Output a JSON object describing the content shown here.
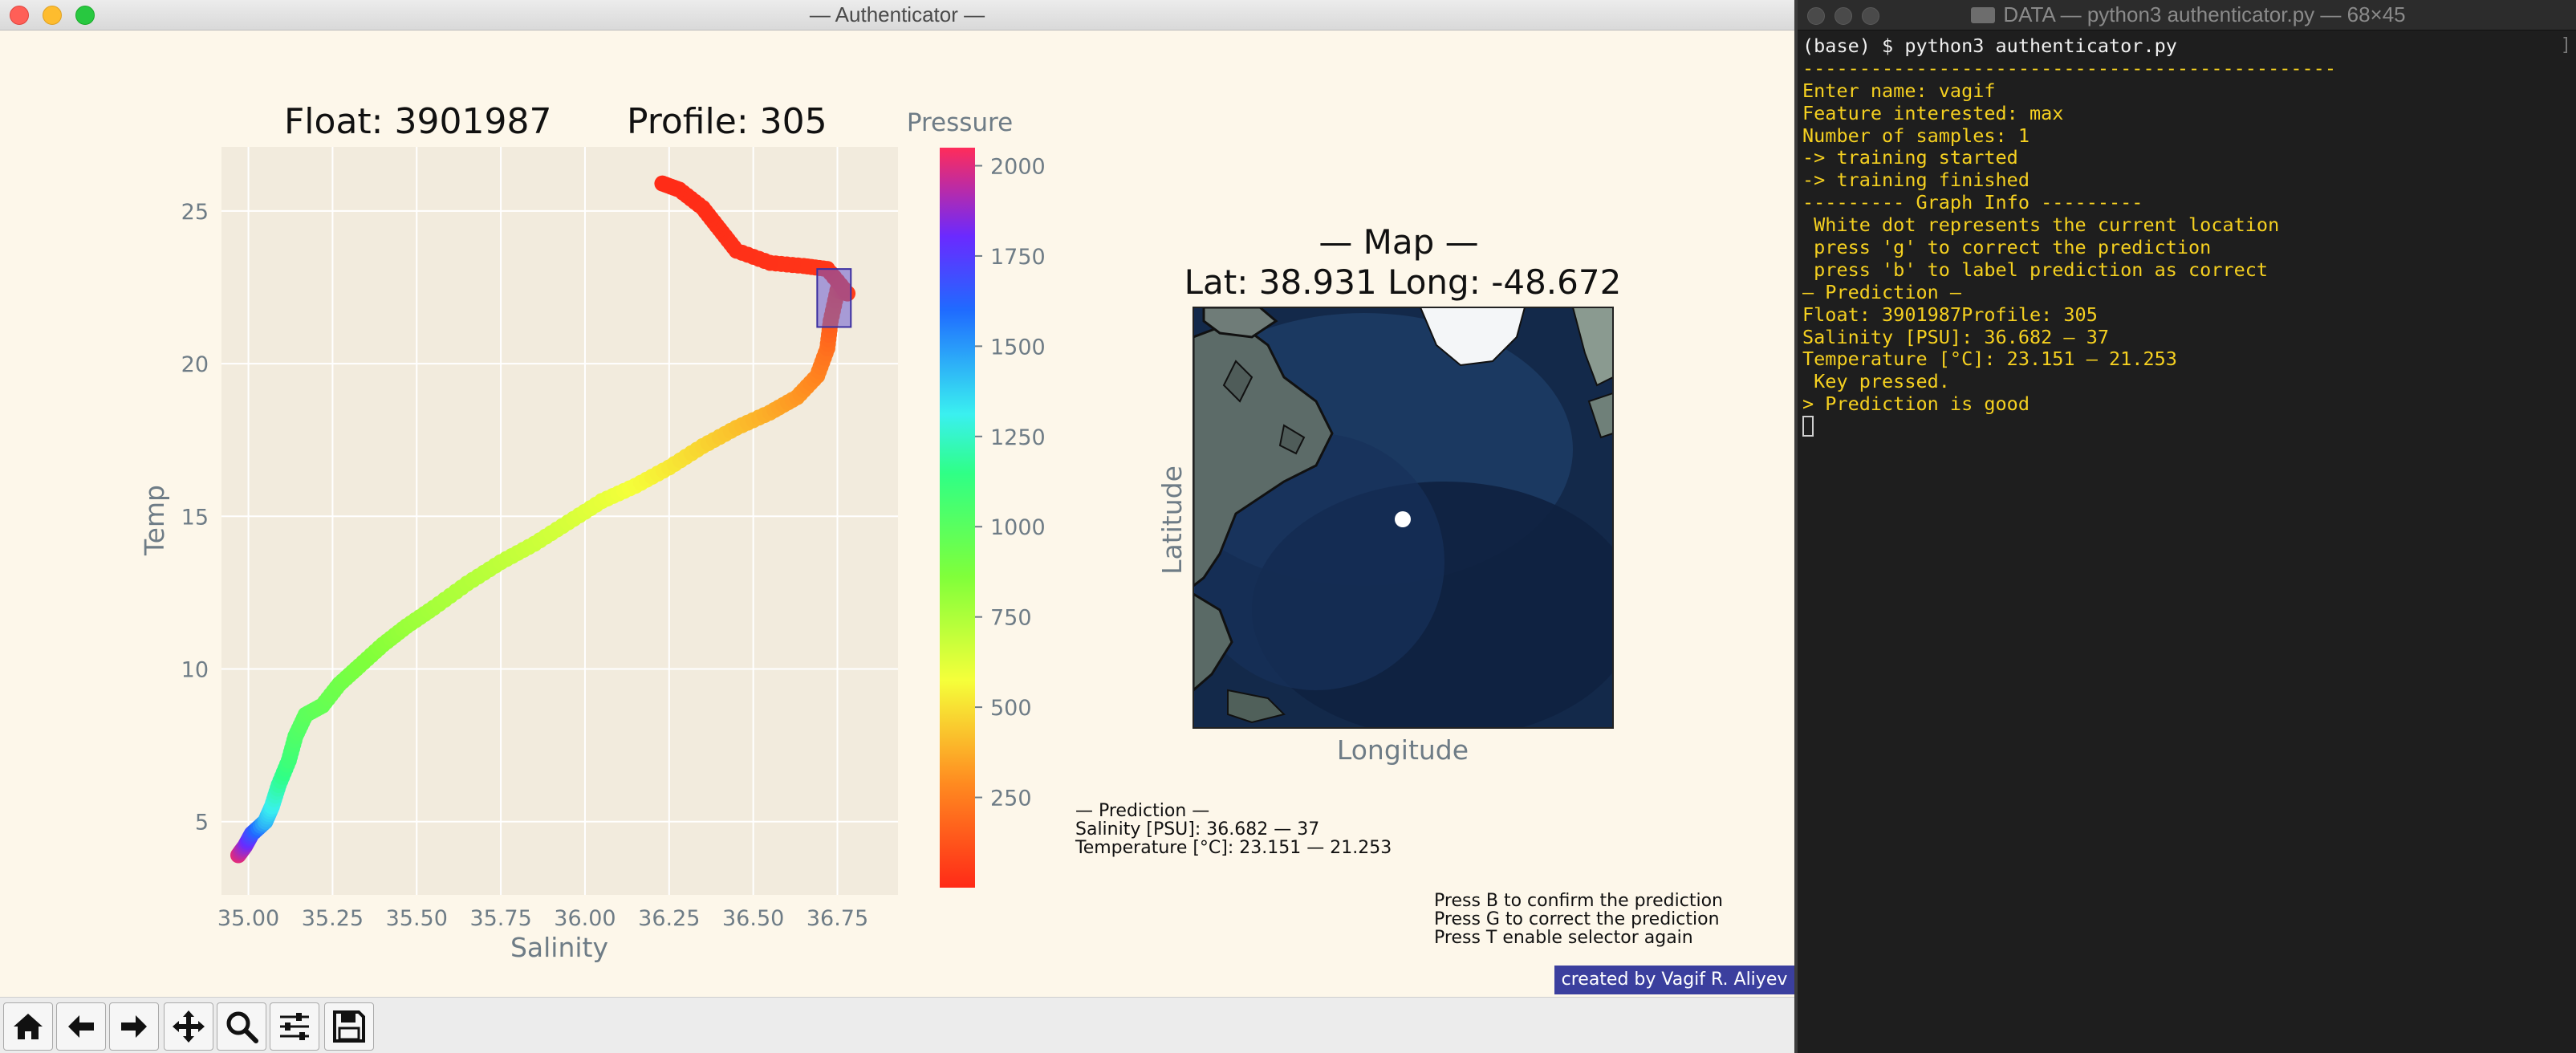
{
  "window": {
    "title": "— Authenticator —"
  },
  "plot": {
    "title_float": "Float: 3901987",
    "title_profile": "Profile: 305",
    "xlabel": "Salinity",
    "ylabel": "Temp",
    "xticks": [
      "35.00",
      "35.25",
      "35.50",
      "35.75",
      "36.00",
      "36.25",
      "36.50",
      "36.75"
    ],
    "yticks": [
      "5",
      "10",
      "15",
      "20",
      "25"
    ],
    "colorbar_label": "Pressure",
    "colorbar_ticks": [
      "2000",
      "1750",
      "1500",
      "1250",
      "1000",
      "750",
      "500",
      "250"
    ]
  },
  "map": {
    "title": "— Map —",
    "coords": "Lat: 38.931 Long: -48.672",
    "xlabel": "Longitude",
    "ylabel": "Latitude"
  },
  "prediction_box": {
    "heading": "— Prediction —",
    "salinity": "Salinity [PSU]: 36.682 — 37",
    "temperature": "Temperature [°C]: 23.151 — 21.253"
  },
  "instructions": [
    "Press B to confirm the prediction",
    "Press G to correct the prediction",
    "Press T enable selector again"
  ],
  "credit": "created by Vagif R. Aliyev",
  "toolbar": [
    {
      "name": "home-icon"
    },
    {
      "name": "back-arrow-icon"
    },
    {
      "name": "forward-arrow-icon"
    },
    {
      "name": "pan-icon"
    },
    {
      "name": "zoom-icon"
    },
    {
      "name": "configure-subplots-icon"
    },
    {
      "name": "save-icon"
    }
  ],
  "terminal": {
    "title": "DATA — python3 authenticator.py — 68×45",
    "lines": [
      "(base) $ python3 authenticator.py",
      "-----------------------------------------------",
      "Enter name: vagif",
      "Feature interested: max",
      "Number of samples: 1",
      "-> training started",
      "-> training finished",
      "--------- Graph Info ---------",
      " White dot represents the current location",
      " press 'g' to correct the prediction",
      " press 'b' to label prediction as correct",
      "— Prediction —",
      "Float: 3901987Profile: 305",
      "Salinity [PSU]: 36.682 — 37",
      "Temperature [°C]: 23.151 — 21.253",
      " Key pressed.",
      "> Prediction is good"
    ]
  },
  "chart_data": {
    "type": "scatter",
    "title": "Float: 3901987      Profile: 305",
    "xlabel": "Salinity",
    "ylabel": "Temp",
    "xlim": [
      34.92,
      36.93
    ],
    "ylim": [
      2.6,
      27.1
    ],
    "colorbar": {
      "label": "Pressure",
      "range": [
        0,
        2050
      ],
      "colormap": "rainbow_r"
    },
    "selection": {
      "x": [
        36.69,
        36.79
      ],
      "y": [
        21.2,
        23.1
      ]
    },
    "points": [
      {
        "x": 34.97,
        "y": 3.9,
        "p": 2000
      },
      {
        "x": 34.99,
        "y": 4.2,
        "p": 1880
      },
      {
        "x": 35.01,
        "y": 4.6,
        "p": 1700
      },
      {
        "x": 35.05,
        "y": 5.0,
        "p": 1450
      },
      {
        "x": 35.07,
        "y": 5.5,
        "p": 1320
      },
      {
        "x": 35.09,
        "y": 6.2,
        "p": 1200
      },
      {
        "x": 35.12,
        "y": 7.0,
        "p": 1100
      },
      {
        "x": 35.14,
        "y": 7.8,
        "p": 1040
      },
      {
        "x": 35.17,
        "y": 8.5,
        "p": 990
      },
      {
        "x": 35.22,
        "y": 8.8,
        "p": 960
      },
      {
        "x": 35.27,
        "y": 9.5,
        "p": 920
      },
      {
        "x": 35.33,
        "y": 10.1,
        "p": 880
      },
      {
        "x": 35.4,
        "y": 10.8,
        "p": 840
      },
      {
        "x": 35.47,
        "y": 11.4,
        "p": 800
      },
      {
        "x": 35.55,
        "y": 12.0,
        "p": 770
      },
      {
        "x": 35.65,
        "y": 12.8,
        "p": 740
      },
      {
        "x": 35.75,
        "y": 13.5,
        "p": 710
      },
      {
        "x": 35.85,
        "y": 14.1,
        "p": 680
      },
      {
        "x": 35.95,
        "y": 14.8,
        "p": 650
      },
      {
        "x": 36.05,
        "y": 15.5,
        "p": 610
      },
      {
        "x": 36.15,
        "y": 16.0,
        "p": 570
      },
      {
        "x": 36.25,
        "y": 16.6,
        "p": 520
      },
      {
        "x": 36.35,
        "y": 17.3,
        "p": 470
      },
      {
        "x": 36.45,
        "y": 17.9,
        "p": 420
      },
      {
        "x": 36.55,
        "y": 18.4,
        "p": 370
      },
      {
        "x": 36.63,
        "y": 18.9,
        "p": 320
      },
      {
        "x": 36.69,
        "y": 19.6,
        "p": 270
      },
      {
        "x": 36.72,
        "y": 20.5,
        "p": 210
      },
      {
        "x": 36.73,
        "y": 21.4,
        "p": 150
      },
      {
        "x": 36.75,
        "y": 22.4,
        "p": 100
      },
      {
        "x": 36.78,
        "y": 22.3,
        "p": 60
      },
      {
        "x": 36.72,
        "y": 23.1,
        "p": 40
      },
      {
        "x": 36.65,
        "y": 23.2,
        "p": 30
      },
      {
        "x": 36.55,
        "y": 23.3,
        "p": 25
      },
      {
        "x": 36.45,
        "y": 23.7,
        "p": 20
      },
      {
        "x": 36.4,
        "y": 24.4,
        "p": 15
      },
      {
        "x": 36.35,
        "y": 25.1,
        "p": 12
      },
      {
        "x": 36.28,
        "y": 25.7,
        "p": 8
      },
      {
        "x": 36.23,
        "y": 25.9,
        "p": 5
      }
    ]
  }
}
